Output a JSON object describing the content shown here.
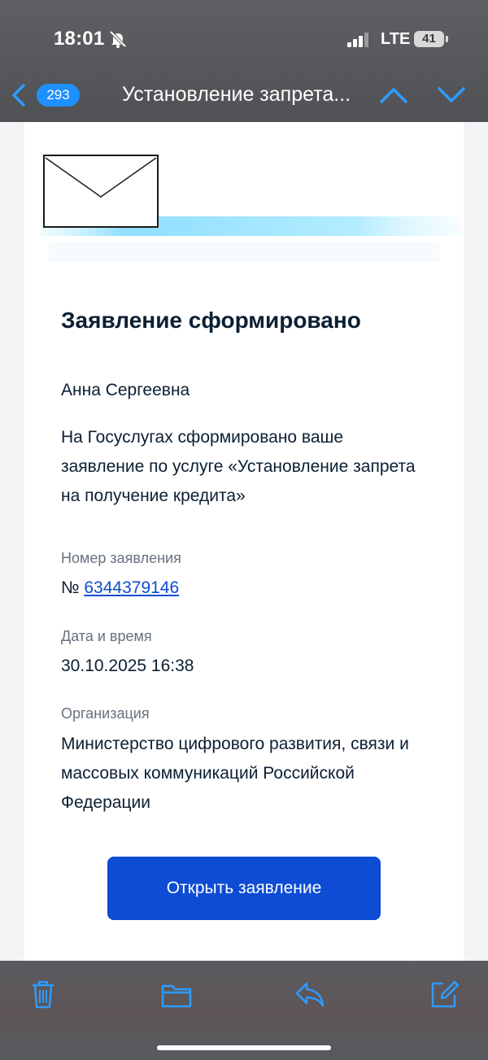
{
  "status_bar": {
    "time": "18:01",
    "network": "LTE",
    "battery": "41"
  },
  "nav": {
    "unread_count": "293",
    "title": "Установление запрета..."
  },
  "email": {
    "heading": "Заявление сформировано",
    "greeting": "Анна Сергеевна",
    "message": "На Госуслугах сформировано ваше заявление по услуге «Установление запрета на получение кредита»",
    "number_label": "Номер заявления",
    "number_prefix": "№",
    "number_value": "6344379146",
    "datetime_label": "Дата и время",
    "datetime_value": "30.10.2025 16:38",
    "org_label": "Организация",
    "org_value": "Министерство цифрового развития, связи и массовых коммуникаций Российской Федерации",
    "button_label": "Открыть заявление"
  },
  "toolbar": {
    "icons": [
      "trash-icon",
      "folder-icon",
      "reply-icon",
      "compose-icon"
    ]
  },
  "colors": {
    "accent": "#0d4cd3",
    "badge": "#1e90ff",
    "ios_blue": "#2f9bff",
    "text": "#0b1f33",
    "muted": "#66727f"
  }
}
